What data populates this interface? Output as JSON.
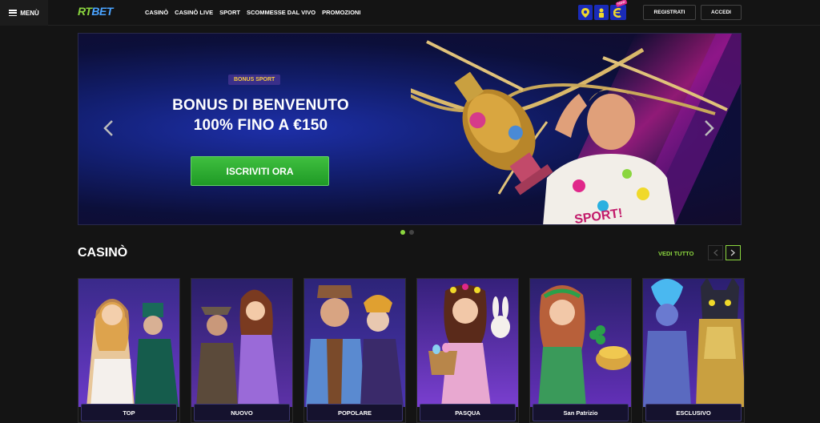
{
  "header": {
    "menu_label": "MENÙ",
    "logo": {
      "part1": "RT",
      "part2": "BET"
    },
    "nav": [
      "CASINÒ",
      "CASINÒ LIVE",
      "SPORT",
      "SCOMMESSE DAL VIVO",
      "PROMOZIONI"
    ],
    "icons": [
      "map-pin-icon",
      "person-icon",
      "new-promo-icon"
    ],
    "new_badge": "New",
    "register_label": "REGISTRATI",
    "login_label": "ACCEDI"
  },
  "hero": {
    "tag": "BONUS SPORT",
    "title_line1": "BONUS DI BENVENUTO",
    "title_line2": "100% FINO A €150",
    "cta_label": "ISCRIVITI ORA",
    "active_slide": 1,
    "slide_count": 2
  },
  "casino": {
    "title": "CASINÒ",
    "see_all": "VEDI TUTTO",
    "tiles": [
      {
        "label": "TOP",
        "colors": [
          "#3a2a8a",
          "#6a3ac8"
        ]
      },
      {
        "label": "NUOVO",
        "colors": [
          "#2a1f6a",
          "#5d32a8"
        ]
      },
      {
        "label": "POPOLARE",
        "colors": [
          "#2d2478",
          "#4b35b0"
        ]
      },
      {
        "label": "PASQUA",
        "colors": [
          "#35207a",
          "#7a3fd0"
        ]
      },
      {
        "label": "San Patrizio",
        "colors": [
          "#2a206c",
          "#6330b8"
        ]
      },
      {
        "label": "ESCLUSIVO",
        "colors": [
          "#2b1f70",
          "#5a2fb4"
        ]
      }
    ]
  },
  "colors": {
    "accent": "#8bd63f",
    "cta": "#2fa83a",
    "brand_blue": "#1a2bb8"
  }
}
